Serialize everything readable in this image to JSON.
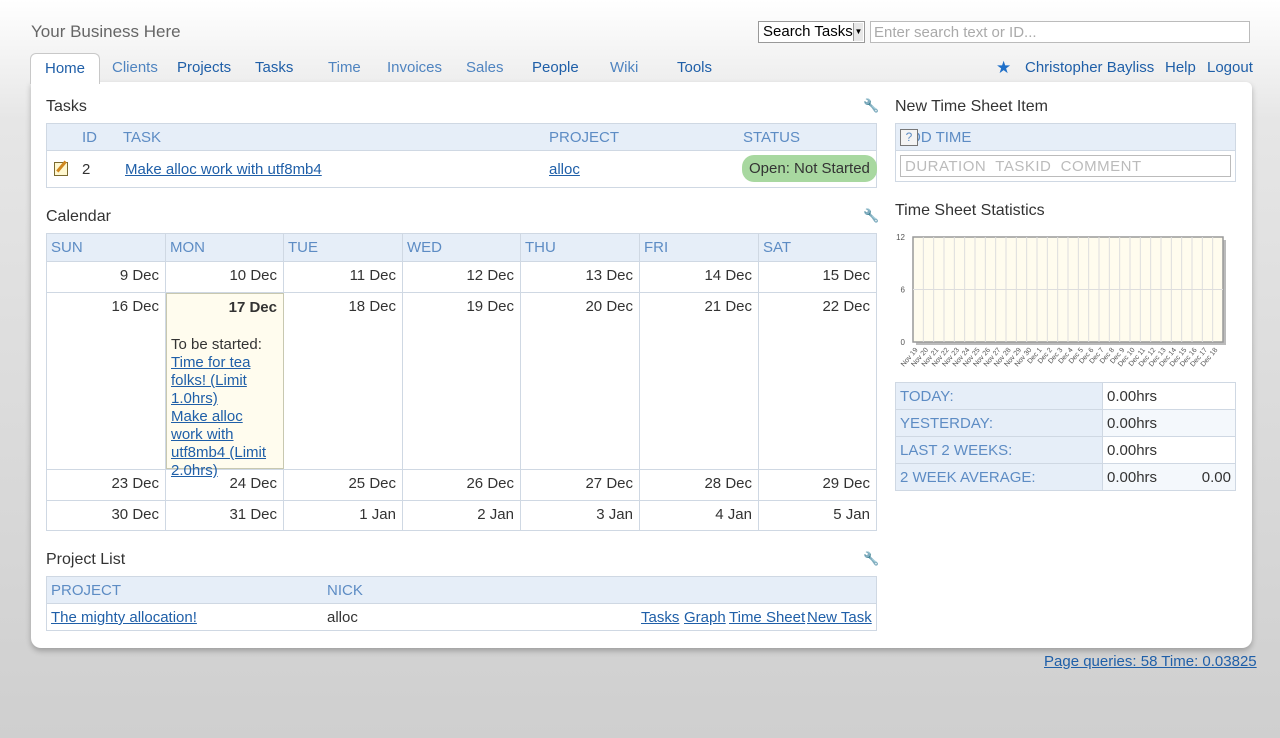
{
  "header": {
    "business_name": "Your Business Here",
    "search_select": "Search Tasks",
    "search_placeholder": "Enter search text or ID..."
  },
  "nav": {
    "tabs": [
      {
        "label": "Home",
        "active": true
      },
      {
        "label": "Clients"
      },
      {
        "label": "Projects"
      },
      {
        "label": "Tasks"
      },
      {
        "label": "Time"
      },
      {
        "label": "Invoices"
      },
      {
        "label": "Sales"
      },
      {
        "label": "People"
      },
      {
        "label": "Wiki"
      },
      {
        "label": "Tools"
      }
    ],
    "user_name": "Christopher Bayliss",
    "help": "Help",
    "logout": "Logout"
  },
  "tasks": {
    "title": "Tasks",
    "columns": [
      "ID",
      "TASK",
      "PROJECT",
      "STATUS"
    ],
    "rows": [
      {
        "id": "2",
        "task": "Make alloc work with utf8mb4",
        "project": "alloc",
        "status": "Open: Not Started"
      }
    ]
  },
  "calendar": {
    "title": "Calendar",
    "days": [
      "SUN",
      "MON",
      "TUE",
      "WED",
      "THU",
      "FRI",
      "SAT"
    ],
    "weeks": [
      [
        "9 Dec",
        "10 Dec",
        "11 Dec",
        "12 Dec",
        "13 Dec",
        "14 Dec",
        "15 Dec"
      ],
      [
        "16 Dec",
        "17 Dec",
        "18 Dec",
        "19 Dec",
        "20 Dec",
        "21 Dec",
        "22 Dec"
      ],
      [
        "23 Dec",
        "24 Dec",
        "25 Dec",
        "26 Dec",
        "27 Dec",
        "28 Dec",
        "29 Dec"
      ],
      [
        "30 Dec",
        "31 Dec",
        "1 Jan",
        "2 Jan",
        "3 Jan",
        "4 Jan",
        "5 Jan"
      ]
    ],
    "today": {
      "label": "To be started:",
      "events": [
        "Time for tea folks! (Limit 1.0hrs)",
        "Make alloc work with utf8mb4 (Limit 2.0hrs)"
      ]
    }
  },
  "project_list": {
    "title": "Project List",
    "columns": [
      "PROJECT",
      "NICK"
    ],
    "rows": [
      {
        "project": "The mighty allocation!",
        "nick": "alloc",
        "links": [
          "Tasks",
          "Graph",
          "Time Sheet",
          "New Task"
        ]
      }
    ]
  },
  "time_sheet": {
    "title": "New Time Sheet Item",
    "header": "ADD TIME",
    "help_icon": "?",
    "placeholder": "DURATION  TASKID  COMMENT"
  },
  "stats": {
    "title": "Time Sheet Statistics",
    "rows": [
      {
        "label": "TODAY:",
        "value": "0.00hrs",
        "extra": ""
      },
      {
        "label": "YESTERDAY:",
        "value": "0.00hrs",
        "extra": ""
      },
      {
        "label": "LAST 2 WEEKS:",
        "value": "0.00hrs",
        "extra": ""
      },
      {
        "label": "2 WEEK AVERAGE:",
        "value": "0.00hrs",
        "extra": "0.00"
      }
    ]
  },
  "chart_data": {
    "type": "bar",
    "categories": [
      "Nov 19",
      "Nov 20",
      "Nov 21",
      "Nov 22",
      "Nov 23",
      "Nov 24",
      "Nov 25",
      "Nov 26",
      "Nov 27",
      "Nov 28",
      "Nov 29",
      "Nov 30",
      "Dec 1",
      "Dec 2",
      "Dec 3",
      "Dec 4",
      "Dec 5",
      "Dec 6",
      "Dec 7",
      "Dec 8",
      "Dec 9",
      "Dec 10",
      "Dec 11",
      "Dec 12",
      "Dec 13",
      "Dec 14",
      "Dec 15",
      "Dec 16",
      "Dec 17",
      "Dec 18"
    ],
    "values": [
      0,
      0,
      0,
      0,
      0,
      0,
      0,
      0,
      0,
      0,
      0,
      0,
      0,
      0,
      0,
      0,
      0,
      0,
      0,
      0,
      0,
      0,
      0,
      0,
      0,
      0,
      0,
      0,
      0,
      0
    ],
    "yticks": [
      "12",
      "6",
      "0"
    ],
    "ylim": [
      0,
      12
    ],
    "grid": true
  },
  "footer": {
    "link": "Page queries: 58 Time: 0.03825"
  },
  "colors": {
    "link": "#1f5fa8",
    "header_bg": "#e6eef8",
    "header_text": "#5d8cc4",
    "status_pill": "#a8d8a0",
    "chart_bg": "#fffcee"
  }
}
